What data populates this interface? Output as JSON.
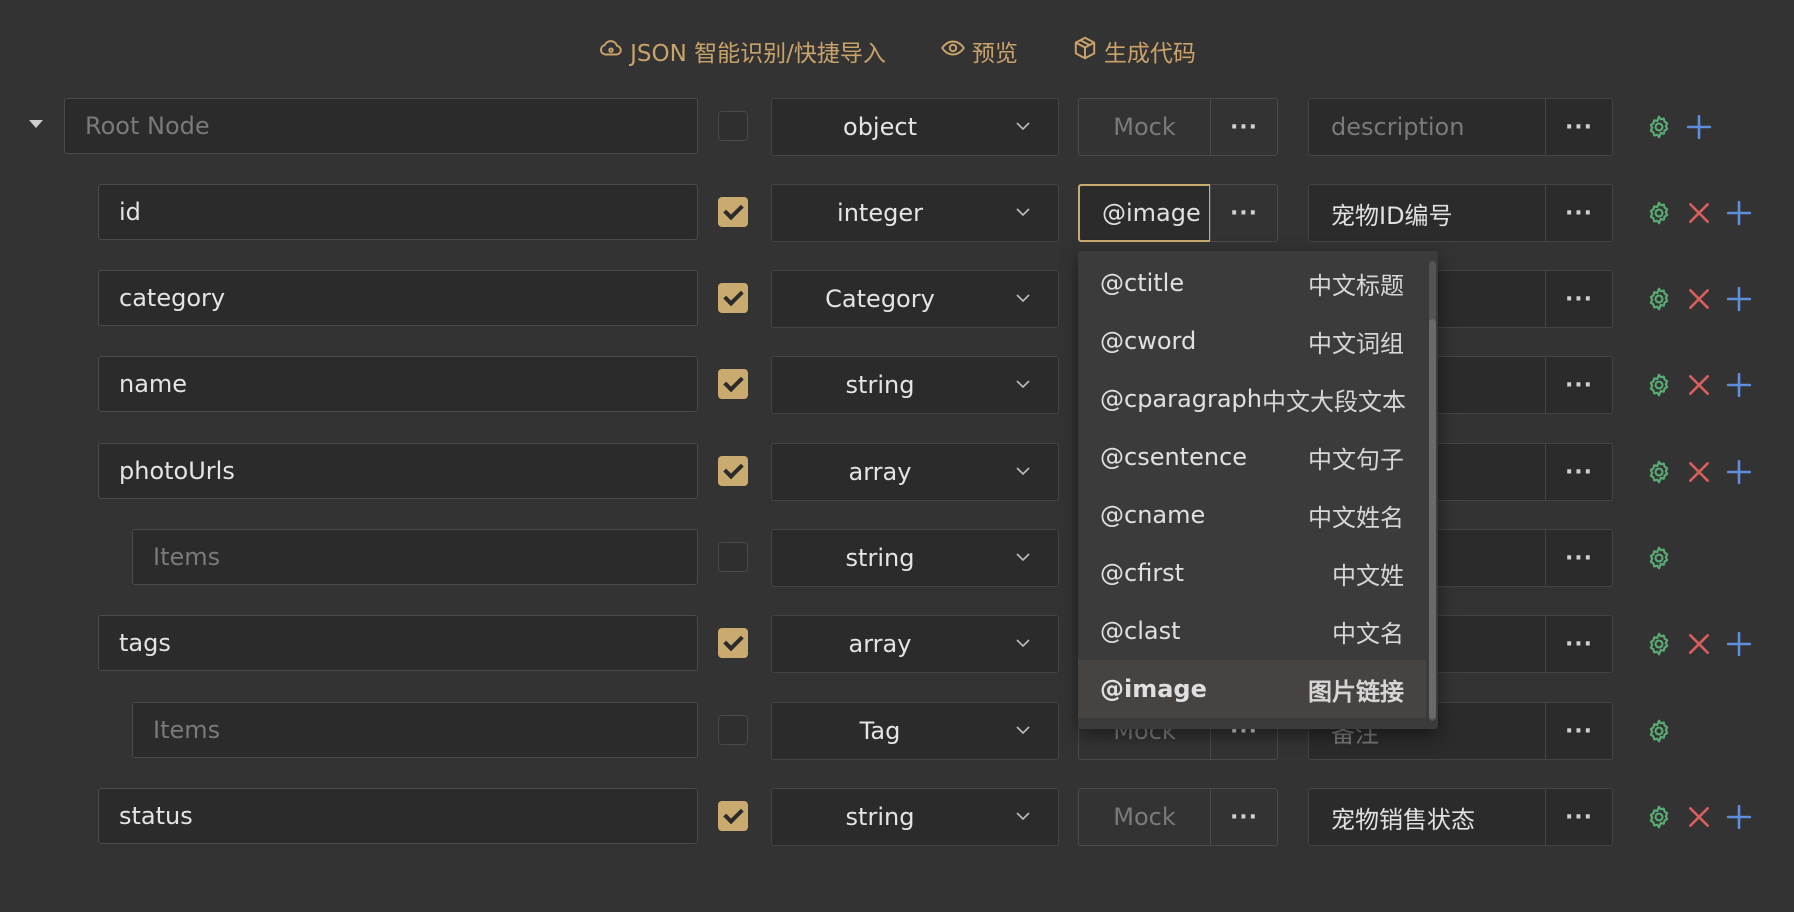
{
  "colors": {
    "accent": "#c9aa6f",
    "gear": "#5aaa74",
    "delete": "#d95f5f",
    "add": "#5d8fdc",
    "background": "#333333"
  },
  "toolbar": {
    "json_import": {
      "icon": "cloud-icon",
      "label": "JSON 智能识别/快捷导入"
    },
    "preview": {
      "icon": "eye-icon",
      "label": "预览"
    },
    "generate": {
      "icon": "cube-icon",
      "label": "生成代码"
    }
  },
  "rows": [
    {
      "name": "",
      "name_placeholder": "Root Node",
      "required": false,
      "type": "object",
      "mock": "",
      "mock_placeholder": "Mock",
      "description": "",
      "description_placeholder": "description",
      "actions": [
        "settings",
        "add"
      ]
    },
    {
      "name": "id",
      "required": true,
      "type": "integer",
      "mock": "@image",
      "mock_placeholder": "",
      "description": "宠物ID编号",
      "actions": [
        "settings",
        "delete",
        "add"
      ]
    },
    {
      "name": "category",
      "required": true,
      "type": "Category",
      "mock": "",
      "mock_placeholder": "",
      "description": "",
      "actions": [
        "settings",
        "delete",
        "add"
      ]
    },
    {
      "name": "name",
      "required": true,
      "type": "string",
      "mock": "",
      "mock_placeholder": "",
      "description": "",
      "actions": [
        "settings",
        "delete",
        "add"
      ]
    },
    {
      "name": "photoUrls",
      "required": true,
      "type": "array",
      "mock": "",
      "mock_placeholder": "",
      "description": "",
      "actions": [
        "settings",
        "delete",
        "add"
      ]
    },
    {
      "name": "",
      "name_placeholder": "Items",
      "required": false,
      "type": "string",
      "mock": "",
      "mock_placeholder": "",
      "description": "",
      "actions": [
        "settings"
      ]
    },
    {
      "name": "tags",
      "required": true,
      "type": "array",
      "mock": "",
      "mock_placeholder": "",
      "description": "",
      "actions": [
        "settings",
        "delete",
        "add"
      ]
    },
    {
      "name": "",
      "name_placeholder": "Items",
      "required": false,
      "type": "Tag",
      "mock": "",
      "mock_placeholder": "Mock",
      "description": "",
      "description_placeholder": "备注",
      "actions": [
        "settings"
      ]
    },
    {
      "name": "status",
      "required": true,
      "type": "string",
      "mock": "",
      "mock_placeholder": "Mock",
      "description": "宠物销售状态",
      "actions": [
        "settings",
        "delete",
        "add"
      ]
    }
  ],
  "mock_dropdown": {
    "selected": "@image",
    "items": [
      {
        "value": "@ctitle",
        "desc": "中文标题"
      },
      {
        "value": "@cword",
        "desc": "中文词组"
      },
      {
        "value": "@cparagraph",
        "desc": "中文大段文本"
      },
      {
        "value": "@csentence",
        "desc": "中文句子"
      },
      {
        "value": "@cname",
        "desc": "中文姓名"
      },
      {
        "value": "@cfirst",
        "desc": "中文姓"
      },
      {
        "value": "@clast",
        "desc": "中文名"
      },
      {
        "value": "@image",
        "desc": "图片链接"
      }
    ]
  }
}
